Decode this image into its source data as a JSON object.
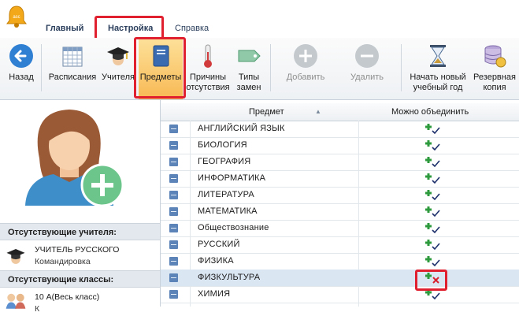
{
  "app": {
    "icon": "bell-icon"
  },
  "menu": {
    "tabs": [
      "Главный",
      "Настройка",
      "Справка"
    ]
  },
  "toolbar": {
    "back": "Назад",
    "schedules": "Расписания",
    "teachers": "Учителя",
    "subjects": "Предметы",
    "absence_reasons": "Причины отсутствия",
    "replacement_types": "Типы замен",
    "add": "Добавить",
    "delete": "Удалить",
    "new_year": "Начать новый учебный год",
    "backup": "Резервная копия"
  },
  "left": {
    "absent_teachers_header": "Отсутствующие учителя:",
    "absent_teacher": {
      "name": "УЧИТЕЛЬ РУССКОГО",
      "reason": "Командировка"
    },
    "absent_classes_header": "Отсутствующие классы:",
    "absent_class": {
      "name": "10 А(Весь класс)",
      "reason": "К"
    }
  },
  "grid": {
    "col_subject": "Предмет",
    "col_combine": "Можно объединить",
    "rows": [
      {
        "name": "АНГЛИЙСКИЙ ЯЗЫК",
        "mark": "check"
      },
      {
        "name": "БИОЛОГИЯ",
        "mark": "check"
      },
      {
        "name": "ГЕОГРАФИЯ",
        "mark": "check"
      },
      {
        "name": "ИНФОРМАТИКА",
        "mark": "check"
      },
      {
        "name": "ЛИТЕРАТУРА",
        "mark": "check"
      },
      {
        "name": "МАТЕМАТИКА",
        "mark": "check"
      },
      {
        "name": "Обществознание",
        "mark": "check"
      },
      {
        "name": "РУССКИЙ",
        "mark": "check"
      },
      {
        "name": "ФИЗИКА",
        "mark": "check"
      },
      {
        "name": "ФИЗКУЛЬТУРА",
        "mark": "cross"
      },
      {
        "name": "ХИМИЯ",
        "mark": "check"
      }
    ]
  },
  "colors": {
    "highlight": "#e0202e",
    "accent": "#2f7fd3",
    "selected_row": "#dbe6f3"
  }
}
